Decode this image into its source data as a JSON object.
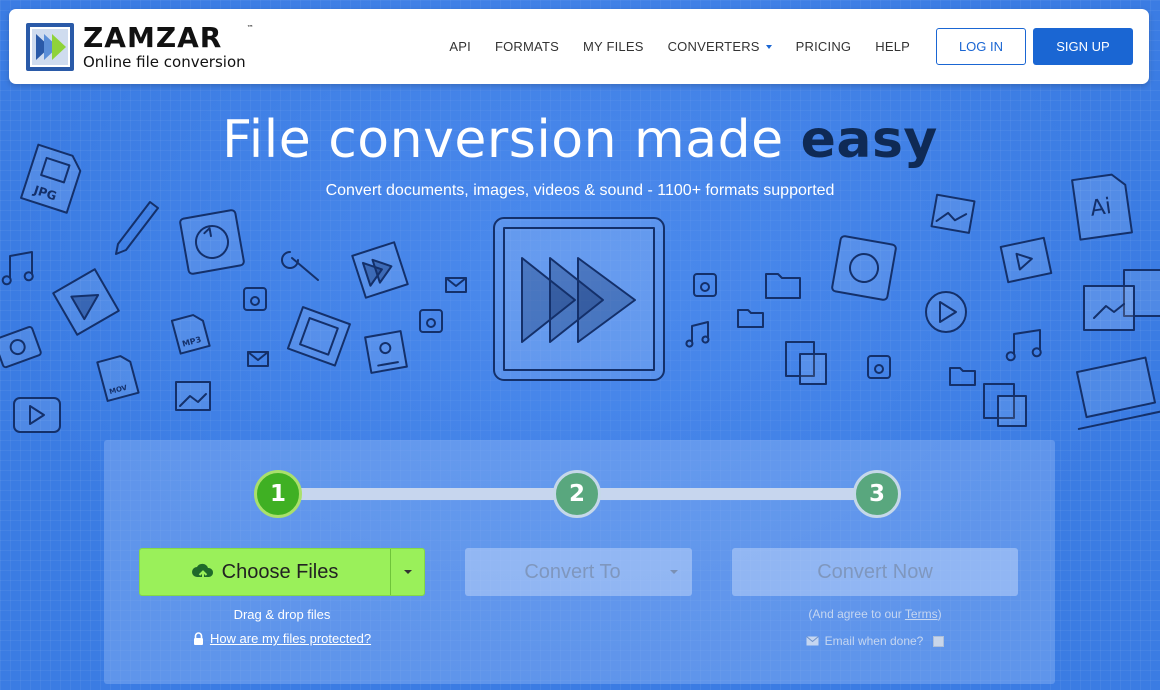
{
  "header": {
    "logo_name": "ZAMZAR",
    "logo_tm": "™",
    "logo_tagline": "Online file conversion",
    "nav": [
      {
        "label": "API"
      },
      {
        "label": "FORMATS"
      },
      {
        "label": "MY FILES"
      },
      {
        "label": "CONVERTERS"
      },
      {
        "label": "PRICING"
      },
      {
        "label": "HELP"
      }
    ],
    "login_label": "LOG IN",
    "signup_label": "SIGN UP"
  },
  "hero": {
    "title_regular": "File conversion made ",
    "title_strong": "easy",
    "subtitle": "Convert documents, images, videos & sound - 1100+ formats supported",
    "doodle_labels": {
      "jpg": "JPG",
      "mp3": "MP3",
      "mov": "MOV",
      "ai": "Ai"
    }
  },
  "converter": {
    "steps": [
      "1",
      "2",
      "3"
    ],
    "active_step": 1,
    "choose_files_label": "Choose Files",
    "drag_drop_text": "Drag & drop files",
    "protection_link": "How are my files protected?",
    "convert_to_label": "Convert To",
    "convert_now_label": "Convert Now",
    "agree_prefix": "(And agree to our ",
    "agree_link": "Terms",
    "agree_suffix": ")",
    "email_label": "Email when done?"
  },
  "colors": {
    "background": "#3b7ce3",
    "brand_blue": "#1a66d3",
    "choose_green": "#9af05a",
    "step_active": "#3fb023",
    "step_inactive": "#59a77e",
    "title_dark": "#0f2a55"
  },
  "icons": [
    "logo-arrows-icon",
    "cloud-upload-icon",
    "lock-icon",
    "envelope-icon",
    "chevron-down-icon",
    "fast-forward-icon"
  ]
}
